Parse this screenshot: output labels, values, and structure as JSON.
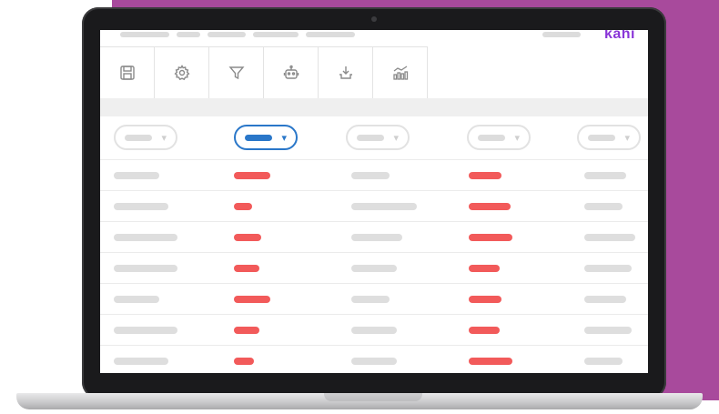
{
  "brand": {
    "name": "kahi",
    "color": "#8a36d8"
  },
  "colors": {
    "background": "#a84a9c",
    "accent": "#2a77c9",
    "highlight": "#f25a5a",
    "placeholder": "#dedede"
  },
  "toolbar": {
    "items": [
      {
        "icon": "save-icon"
      },
      {
        "icon": "gear-icon"
      },
      {
        "icon": "filter-icon"
      },
      {
        "icon": "robot-icon"
      },
      {
        "icon": "download-icon"
      },
      {
        "icon": "chart-icon"
      }
    ]
  },
  "filters": {
    "columns": [
      {
        "state": "inactive"
      },
      {
        "state": "active"
      },
      {
        "state": "inactive"
      },
      {
        "state": "inactive"
      },
      {
        "state": "inactive"
      }
    ],
    "dropdown_glyph": "▾"
  },
  "table": {
    "row_count": 7,
    "highlighted_columns": [
      2,
      4
    ]
  }
}
